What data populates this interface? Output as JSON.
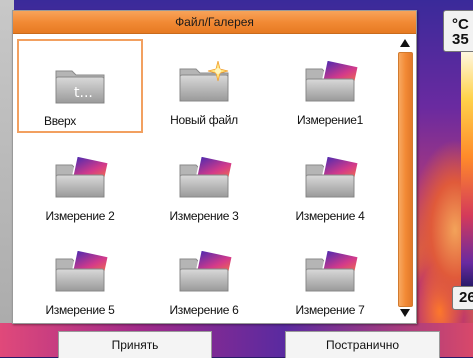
{
  "dialog": {
    "title": "Файл/Галерея"
  },
  "items": [
    {
      "label": "Вверх",
      "kind": "up",
      "selected": true
    },
    {
      "label": "Новый файл",
      "kind": "new"
    },
    {
      "label": "Измерение1",
      "kind": "measure"
    },
    {
      "label": "Измерение 2",
      "kind": "measure"
    },
    {
      "label": "Измерение 3",
      "kind": "measure"
    },
    {
      "label": "Измерение 4",
      "kind": "measure"
    },
    {
      "label": "Измерение 5",
      "kind": "measure"
    },
    {
      "label": "Измерение 6",
      "kind": "measure"
    },
    {
      "label": "Измерение 7",
      "kind": "measure"
    }
  ],
  "buttons": {
    "accept": "Принять",
    "page": "Постранично"
  },
  "thermal": {
    "top_label_unit": "°C",
    "top_label_value": "35",
    "bottom_label_value": "26"
  },
  "colors": {
    "accent": "#f28a35",
    "selection_border": "#f2a060"
  },
  "icons": {
    "up": "folder-up-icon",
    "new": "folder-new-icon",
    "measure": "folder-thermal-image-icon"
  }
}
